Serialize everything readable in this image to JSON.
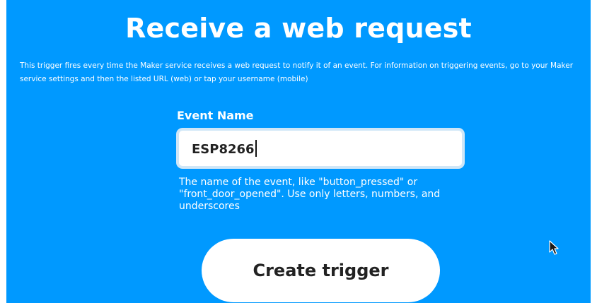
{
  "page": {
    "title": "Receive a web request",
    "description": "This trigger fires every time the Maker service receives a web request to notify it of an event. For information on triggering events, go to your Maker service settings and then the listed URL (web) or tap your username (mobile)"
  },
  "event_name_field": {
    "label": "Event Name",
    "value": "ESP8266",
    "helper_text": "The name of the event, like \"button_pressed\" or \"front_door_opened\". Use only letters, numbers, and underscores"
  },
  "actions": {
    "create_trigger_label": "Create trigger"
  },
  "colors": {
    "background": "#0099ff",
    "text": "#ffffff",
    "button_background": "#ffffff",
    "button_text": "#222222"
  },
  "icons": {
    "pointer": "mouse-pointer-icon"
  }
}
